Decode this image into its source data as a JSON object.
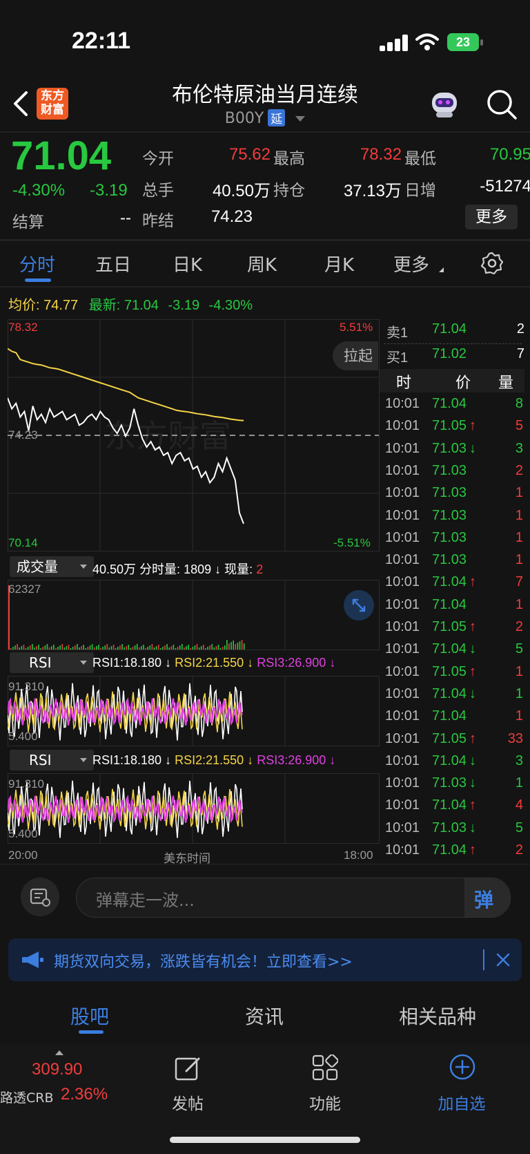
{
  "status_bar": {
    "time": "22:11",
    "battery": "23"
  },
  "header": {
    "logo_text_line1": "东方",
    "logo_text_line2": "财富",
    "title": "布伦特原油当月连续",
    "code": "B00Y",
    "delay_badge": "延"
  },
  "quote": {
    "price": "71.04",
    "change_pct": "-4.30%",
    "change": "-3.19",
    "settle_label": "结算",
    "settle_value": "--",
    "fields": [
      {
        "label": "今开",
        "value": "75.62",
        "color": "#f23c3c"
      },
      {
        "label": "最高",
        "value": "78.32",
        "color": "#f23c3c"
      },
      {
        "label": "最低",
        "value": "70.95",
        "color": "#28c840"
      },
      {
        "label": "总手",
        "value": "40.50万",
        "color": "#ffffff"
      },
      {
        "label": "持仓",
        "value": "37.13万",
        "color": "#ffffff"
      },
      {
        "label": "日增",
        "value": "-51274",
        "color": "#ffffff"
      },
      {
        "label": "昨结",
        "value": "74.23",
        "color": "#ffffff"
      }
    ],
    "more_button": "更多"
  },
  "tabs": [
    "分时",
    "五日",
    "日K",
    "周K",
    "月K",
    "更多"
  ],
  "active_tab": "分时",
  "avg_row": {
    "avg_label": "均价:",
    "avg_value": "74.77",
    "latest_label": "最新:",
    "latest_value": "71.04",
    "change": "-3.19",
    "change_pct": "-4.30%"
  },
  "chart_data": {
    "type": "line",
    "title": "",
    "y_max_label": "78.32",
    "y_mid_label": "74.23",
    "y_min_label": "70.14",
    "pct_max_label": "5.51%",
    "pct_min_label": "-5.51%",
    "x_start_label": "20:00",
    "x_mid_label": "美东时间",
    "x_end_label": "18:00",
    "ylim": [
      70.14,
      78.32
    ],
    "prev_settle": 74.23,
    "series": [
      {
        "name": "",
        "color": "#ffffff",
        "values": [
          75.6,
          75.2,
          75.4,
          74.9,
          75.1,
          74.4,
          75.3,
          74.8,
          75.0,
          74.7,
          75.2,
          74.9,
          75.0,
          75.1,
          74.8,
          74.9,
          75.0,
          74.6,
          74.7,
          74.9,
          75.0,
          74.8,
          75.1,
          74.9,
          74.8,
          74.5,
          74.3,
          74.6,
          74.2,
          74.5,
          75.2,
          74.6,
          74.1,
          73.8,
          74.0,
          73.7,
          73.8,
          73.5,
          73.6,
          73.2,
          73.5,
          73.6,
          73.3,
          73.4,
          73.0,
          73.1,
          72.7,
          72.9,
          72.5,
          72.7,
          73.2,
          72.9,
          73.4,
          73.0,
          72.6,
          71.4,
          71.0
        ]
      },
      {
        "name": "",
        "color": "#f5d547",
        "values": [
          77.4,
          77.3,
          77.25,
          77.0,
          76.95,
          76.9,
          76.85,
          76.82,
          76.8,
          76.75,
          76.7,
          76.68,
          76.65,
          76.6,
          76.55,
          76.5,
          76.45,
          76.4,
          76.35,
          76.3,
          76.25,
          76.2,
          76.15,
          76.1,
          76.05,
          76.0,
          75.95,
          75.9,
          75.85,
          75.8,
          75.7,
          75.6,
          75.55,
          75.5,
          75.45,
          75.4,
          75.35,
          75.3,
          75.25,
          75.2,
          75.15,
          75.12,
          75.1,
          75.08,
          75.05,
          75.02,
          75.0,
          74.98,
          74.95,
          74.92,
          74.9,
          74.88,
          74.85,
          74.82,
          74.8,
          74.78,
          74.77
        ]
      }
    ]
  },
  "volume": {
    "selector": "成交量",
    "total": "40.50万",
    "tick_label": "分时量:",
    "tick_value": "1809",
    "now_label": "现量:",
    "now_value": "2",
    "max_label": "62327"
  },
  "rsi": {
    "selector": "RSI",
    "rsi1": "RSI1:18.180",
    "rsi2": "RSI2:21.550",
    "rsi3": "RSI3:26.900",
    "top_label": "91.310",
    "bottom_label": "5.400"
  },
  "side_buttons": {
    "pull_up": "拉起"
  },
  "order_book": [
    {
      "label": "卖1",
      "price": "71.04",
      "vol": "2"
    },
    {
      "label": "买1",
      "price": "71.02",
      "vol": "7"
    }
  ],
  "ticks_header": {
    "time": "时",
    "price": "价",
    "vol": "量"
  },
  "ticks": [
    {
      "t": "10:01",
      "p": "71.04",
      "arrow": "",
      "v": "8",
      "vc": "#28c840"
    },
    {
      "t": "10:01",
      "p": "71.05",
      "arrow": "↑",
      "v": "5",
      "vc": "#f23c3c"
    },
    {
      "t": "10:01",
      "p": "71.03",
      "arrow": "↓",
      "v": "3",
      "vc": "#28c840"
    },
    {
      "t": "10:01",
      "p": "71.03",
      "arrow": "",
      "v": "2",
      "vc": "#f23c3c"
    },
    {
      "t": "10:01",
      "p": "71.03",
      "arrow": "",
      "v": "1",
      "vc": "#f23c3c"
    },
    {
      "t": "10:01",
      "p": "71.03",
      "arrow": "",
      "v": "1",
      "vc": "#f23c3c"
    },
    {
      "t": "10:01",
      "p": "71.03",
      "arrow": "",
      "v": "1",
      "vc": "#f23c3c"
    },
    {
      "t": "10:01",
      "p": "71.03",
      "arrow": "",
      "v": "1",
      "vc": "#f23c3c"
    },
    {
      "t": "10:01",
      "p": "71.04",
      "arrow": "↑",
      "v": "7",
      "vc": "#f23c3c"
    },
    {
      "t": "10:01",
      "p": "71.04",
      "arrow": "",
      "v": "1",
      "vc": "#f23c3c"
    },
    {
      "t": "10:01",
      "p": "71.05",
      "arrow": "↑",
      "v": "2",
      "vc": "#f23c3c"
    },
    {
      "t": "10:01",
      "p": "71.04",
      "arrow": "↓",
      "v": "5",
      "vc": "#28c840"
    },
    {
      "t": "10:01",
      "p": "71.05",
      "arrow": "↑",
      "v": "1",
      "vc": "#f23c3c"
    },
    {
      "t": "10:01",
      "p": "71.04",
      "arrow": "↓",
      "v": "1",
      "vc": "#28c840"
    },
    {
      "t": "10:01",
      "p": "71.04",
      "arrow": "",
      "v": "1",
      "vc": "#f23c3c"
    },
    {
      "t": "10:01",
      "p": "71.05",
      "arrow": "↑",
      "v": "33",
      "vc": "#f23c3c"
    },
    {
      "t": "10:01",
      "p": "71.04",
      "arrow": "↓",
      "v": "3",
      "vc": "#28c840"
    },
    {
      "t": "10:01",
      "p": "71.03",
      "arrow": "↓",
      "v": "1",
      "vc": "#28c840"
    },
    {
      "t": "10:01",
      "p": "71.04",
      "arrow": "↑",
      "v": "4",
      "vc": "#f23c3c"
    },
    {
      "t": "10:01",
      "p": "71.03",
      "arrow": "↓",
      "v": "5",
      "vc": "#28c840"
    },
    {
      "t": "10:01",
      "p": "71.04",
      "arrow": "↑",
      "v": "2",
      "vc": "#f23c3c"
    }
  ],
  "danmu": {
    "placeholder": "弹幕走一波...",
    "send": "弹"
  },
  "banner": {
    "text": "期货双向交易，涨跌皆有机会！立即查看>>"
  },
  "bottom_tabs": [
    "股吧",
    "资讯",
    "相关品种"
  ],
  "ticker": {
    "value": "309.90",
    "name": "路透CRB",
    "pct": "2.36%"
  },
  "nav": [
    {
      "label": "发帖"
    },
    {
      "label": "功能"
    },
    {
      "label": "加自选"
    }
  ],
  "watermark": "东方财富",
  "colors": {
    "up": "#f23c3c",
    "down": "#28c840",
    "accent": "#3c7ee0",
    "avg": "#f5d547"
  }
}
